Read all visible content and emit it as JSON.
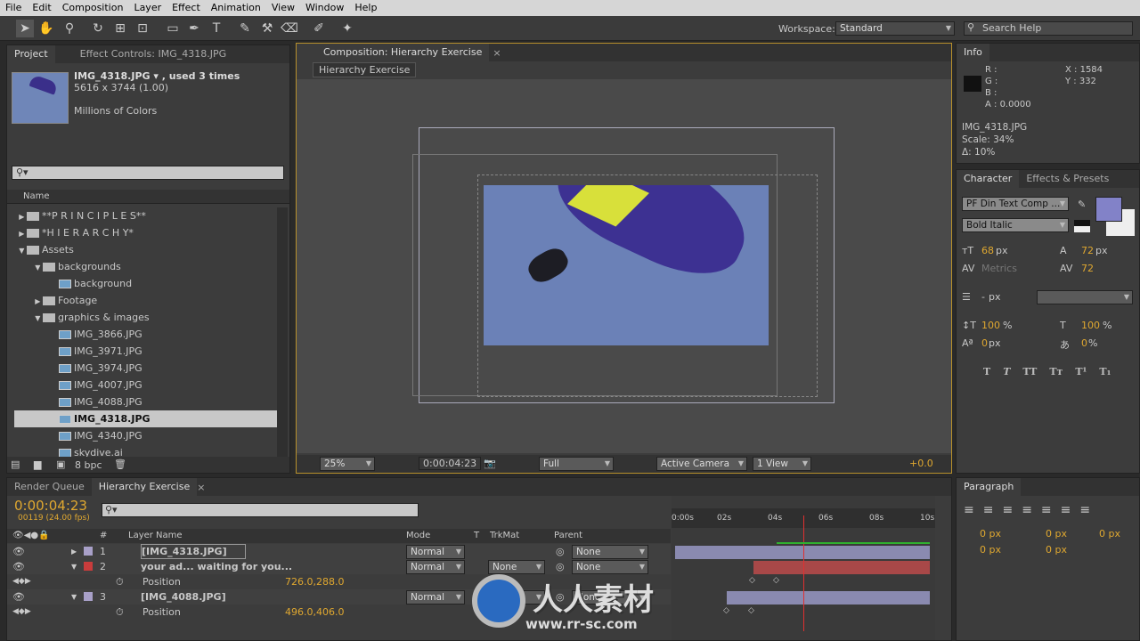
{
  "menu": [
    "File",
    "Edit",
    "Composition",
    "Layer",
    "Effect",
    "Animation",
    "View",
    "Window",
    "Help"
  ],
  "toolbar": {
    "workspace_label": "Workspace:",
    "workspace_value": "Standard",
    "search_placeholder": "Search Help"
  },
  "project": {
    "tabs": [
      "Project",
      "Effect Controls: IMG_4318.JPG"
    ],
    "selected_name": "IMG_4318.JPG ▾ , used 3 times",
    "selected_dims": "5616 x 3744 (1.00)",
    "selected_colors": "Millions of Colors",
    "column_name": "Name",
    "items": [
      {
        "label": "**P R I N C I P L E S**",
        "type": "folder",
        "indent": 0,
        "arrow": "▶"
      },
      {
        "label": "*H I E R A R C H Y*",
        "type": "folder",
        "indent": 0,
        "arrow": "▶"
      },
      {
        "label": "Assets",
        "type": "folder",
        "indent": 0,
        "arrow": "▼"
      },
      {
        "label": "backgrounds",
        "type": "folder",
        "indent": 1,
        "arrow": "▼"
      },
      {
        "label": "background",
        "type": "comp",
        "indent": 2,
        "arrow": ""
      },
      {
        "label": "Footage",
        "type": "folder",
        "indent": 1,
        "arrow": "▶"
      },
      {
        "label": "graphics & images",
        "type": "folder",
        "indent": 1,
        "arrow": "▼"
      },
      {
        "label": "IMG_3866.JPG",
        "type": "image",
        "indent": 2,
        "arrow": ""
      },
      {
        "label": "IMG_3971.JPG",
        "type": "image",
        "indent": 2,
        "arrow": ""
      },
      {
        "label": "IMG_3974.JPG",
        "type": "image",
        "indent": 2,
        "arrow": ""
      },
      {
        "label": "IMG_4007.JPG",
        "type": "image",
        "indent": 2,
        "arrow": ""
      },
      {
        "label": "IMG_4088.JPG",
        "type": "image",
        "indent": 2,
        "arrow": ""
      },
      {
        "label": "IMG_4318.JPG",
        "type": "image",
        "indent": 2,
        "arrow": "",
        "selected": true
      },
      {
        "label": "IMG_4340.JPG",
        "type": "image",
        "indent": 2,
        "arrow": ""
      },
      {
        "label": "skydive.ai",
        "type": "ai",
        "indent": 2,
        "arrow": ""
      }
    ],
    "bpc": "8 bpc"
  },
  "composition": {
    "tab": "Composition: Hierarchy Exercise",
    "breadcrumb": "Hierarchy Exercise",
    "zoom": "25%",
    "timecode": "0:00:04:23",
    "resolution": "Full",
    "camera": "Active Camera",
    "views": "1 View",
    "exposure": "+0.0"
  },
  "info": {
    "tab": "Info",
    "r": "R :",
    "g": "G :",
    "b": "B :",
    "a": "A : 0.0000",
    "x": "X : 1584",
    "y": "Y : 332",
    "file": "IMG_4318.JPG",
    "scale": "Scale: 34%",
    "delta": "Δ: 10%"
  },
  "character": {
    "tabs": [
      "Character",
      "Effects & Presets"
    ],
    "font": "PF Din Text Comp ...",
    "style": "Bold Italic",
    "size": "68",
    "size_unit": "px",
    "leading": "72",
    "leading_unit": "px",
    "kerning": "Metrics",
    "tracking": "72",
    "stroke": "-",
    "stroke_unit": "px",
    "vscale": "100",
    "vscale_unit": "%",
    "hscale": "100",
    "hscale_unit": "%",
    "baseline": "0",
    "baseline_unit": "px",
    "tsume": "0",
    "tsume_unit": "%",
    "fill_color": "#8282c8",
    "styles": [
      "T",
      "T",
      "TT",
      "Tт",
      "T¹",
      "T₁"
    ]
  },
  "paragraph": {
    "tab": "Paragraph",
    "indent_left": "0 px",
    "indent_first": "0 px",
    "indent_right": "0 px",
    "space_before": "0 px",
    "space_after": "0 px"
  },
  "timeline": {
    "tabs": [
      "Render Queue",
      "Hierarchy Exercise"
    ],
    "timecode": "0:00:04:23",
    "frames": "00119 (24.00 fps)",
    "headers": {
      "num": "#",
      "layer_name": "Layer Name",
      "mode": "Mode",
      "t": "T",
      "trkmat": "TrkMat",
      "parent": "Parent"
    },
    "ruler": [
      "0:00s",
      "02s",
      "04s",
      "06s",
      "08s",
      "10s"
    ],
    "layers": [
      {
        "num": "1",
        "name": "[IMG_4318.JPG]",
        "color": "#a8a0c8",
        "mode": "Normal",
        "trkmat": "",
        "parent": "None"
      },
      {
        "num": "2",
        "name": "your ad... waiting for you...",
        "color": "#c83c3c",
        "mode": "Normal",
        "trkmat": "None",
        "parent": "None",
        "property": "Position",
        "value": "726.0,288.0"
      },
      {
        "num": "3",
        "name": "[IMG_4088.JPG]",
        "color": "#a8a0c8",
        "mode": "Normal",
        "trkmat": "None",
        "parent": "None",
        "property": "Position",
        "value": "496.0,406.0"
      }
    ]
  },
  "watermark": {
    "text": "人人素材",
    "url": "www.rr-sc.com"
  }
}
